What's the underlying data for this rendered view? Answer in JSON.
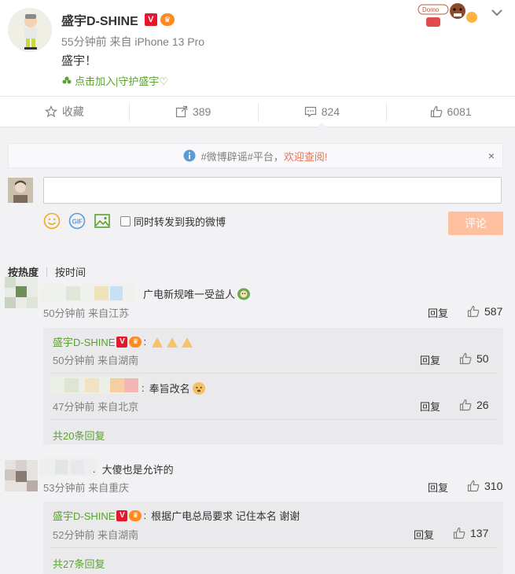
{
  "post": {
    "username": "盛宇D-SHINE",
    "verified_badge": "V",
    "time": "55分钟前",
    "source": "来自 iPhone 13 Pro",
    "text": "盛宇！",
    "join_link": "点击加入|守护盛宇♡"
  },
  "actions": {
    "collect_label": "收藏",
    "forward_count": "389",
    "comment_count": "824",
    "like_count": "6081"
  },
  "notice": {
    "prefix": "#微博辟谣#平台，",
    "highlight": "欢迎查阅!",
    "close": "×"
  },
  "composer": {
    "input_value": "",
    "forward_label": "同时转发到我的微博",
    "submit_label": "评论"
  },
  "sort": {
    "hot": "按热度",
    "time": "按时间"
  },
  "comments": [
    {
      "text": "广电新规唯一受益人",
      "meta": "50分钟前 来自江苏",
      "reply_label": "回复",
      "likes": "587",
      "replies": [
        {
          "name": "盛宇D-SHINE",
          "text": "",
          "meta": "50分钟前 来自湖南",
          "reply_label": "回复",
          "likes": "50"
        },
        {
          "name": "",
          "text": "奉旨改名",
          "meta": "47分钟前 来自北京",
          "reply_label": "回复",
          "likes": "26"
        }
      ],
      "more_replies": "共20条回复"
    },
    {
      "text": "大傻也是允许的",
      "meta": "53分钟前 来自重庆",
      "reply_label": "回复",
      "likes": "310",
      "replies": [
        {
          "name": "盛宇D-SHINE",
          "text": "根据广电总局要求 记住本名 谢谢",
          "meta": "52分钟前 来自湖南",
          "reply_label": "回复",
          "likes": "137"
        }
      ],
      "more_replies": "共27条回复"
    }
  ],
  "colors": {
    "link_green": "#5aa230",
    "verified_red": "#e6162d",
    "submit_disabled": "#ffc09f",
    "notice_orange": "#eb7350",
    "panel_bg": "#f2f2f5"
  }
}
